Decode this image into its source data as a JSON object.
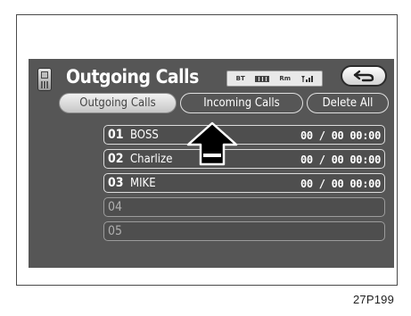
{
  "header": {
    "title": "Outgoing Calls",
    "status_icons": {
      "bluetooth": "BT",
      "battery": "battery-icon",
      "roaming": "Rm",
      "signal": "signal-strength-icon"
    },
    "back_icon": "back-arrow-icon"
  },
  "tabs": [
    {
      "label": "Outgoing Calls",
      "active": true
    },
    {
      "label": "Incoming Calls",
      "active": false
    },
    {
      "label": "Delete All",
      "active": false
    }
  ],
  "calls": [
    {
      "number": "01",
      "name": "BOSS",
      "time": "00 / 00 00:00"
    },
    {
      "number": "02",
      "name": "Charlize",
      "time": "00 / 00 00:00"
    },
    {
      "number": "03",
      "name": "MIKE",
      "time": "00 / 00 00:00"
    },
    {
      "number": "04",
      "name": "",
      "time": ""
    },
    {
      "number": "05",
      "name": "",
      "time": ""
    }
  ],
  "figure_id": "27P199",
  "colors": {
    "screen_bg": "#565656",
    "button_border": "#e0e0e0",
    "text": "#ffffff"
  }
}
